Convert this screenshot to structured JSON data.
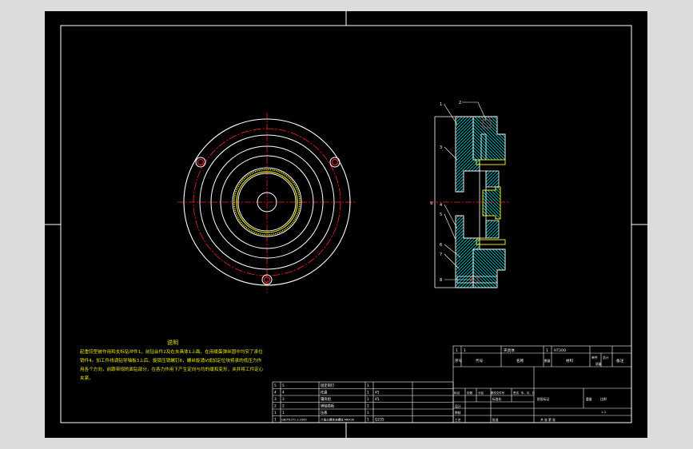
{
  "notes": {
    "title": "说明",
    "body": "起重铰型被作用和支标钻冲件1，前钻会件2及在夹具体1上面，在用缓蛋弹丝固中均安了承位销件4。加工件线调钻导轴板3上后，旋锁压销螺钉6，螺丝旋涌V成加定位块将承的低压力作用各个方向，前跟带规的面钻部分，在各力作用下产生定向与均的缓和变形，夹并将工件定心夹紧。"
  },
  "bom_rows": [
    {
      "no": "5",
      "code": "5",
      "name": "固定销钉",
      "qty": "1",
      "material": ""
    },
    {
      "no": "4",
      "code": "4",
      "name": "托盘",
      "qty": "1",
      "material": "45"
    },
    {
      "no": "3",
      "code": "3",
      "name": "镶块组",
      "qty": "1",
      "material": "45"
    },
    {
      "no": "2",
      "code": "2",
      "name": "销轴盖板",
      "qty": "1",
      "material": ""
    },
    {
      "no": "1",
      "code": "1",
      "name": "压板",
      "qty": "1",
      "material": ""
    },
    {
      "no": "1",
      "code": "GB/T6170.1-2000",
      "name": "六角头螺栓全螺纹 M6X30",
      "qty": "1",
      "material": "Q235"
    }
  ],
  "title_block": {
    "part_row": {
      "no": "1",
      "code": "1",
      "name": "夹具体",
      "qty": "1",
      "material": "HT200"
    },
    "header": {
      "no": "序号",
      "code": "代号",
      "name": "名称",
      "qty": "数量",
      "material": "材料",
      "unit_mass": "单件",
      "total_mass": "总计",
      "mass_label": "质量",
      "remark": "备注"
    },
    "sign_labels": [
      "标记",
      "处数",
      "分区",
      "更改文件号",
      "签名",
      "年、月、日"
    ],
    "left_labels": [
      "设计",
      "审核",
      "工艺"
    ],
    "std_label": "标准化",
    "approve_label": "批准",
    "stage_label": "阶段标记",
    "weight_label": "重量",
    "scale_label": "比例",
    "scale_value": "1:1",
    "sheet_label": "共  张  第  张"
  },
  "section_labels": [
    "1",
    "2",
    "3",
    "4",
    "5",
    "6",
    "7",
    "8",
    "9"
  ]
}
